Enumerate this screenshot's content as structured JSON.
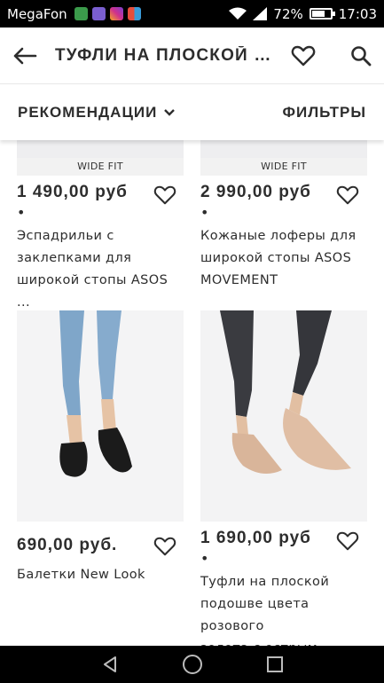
{
  "status_bar": {
    "carrier": "MegaFon",
    "battery": "72%",
    "time": "17:03",
    "battery_level": 0.72
  },
  "header": {
    "title": "ТУФЛИ НА ПЛОСКОЙ П..."
  },
  "sort_bar": {
    "sort_label": "РЕКОМЕНДАЦИИ",
    "filters_label": "ФИЛЬТРЫ"
  },
  "products": [
    {
      "badge": "WIDE FIT",
      "price": "1 490,00 руб",
      "dot": "•",
      "name_lines": [
        "Эспадрильи с",
        "заклепками для",
        "широкой стопы ASOS ..."
      ]
    },
    {
      "badge": "WIDE FIT",
      "price": "2 990,00 руб",
      "dot": "•",
      "name_lines": [
        "Кожаные лоферы для",
        "широкой стопы ASOS",
        "MOVEMENT"
      ]
    },
    {
      "price": "690,00 руб.",
      "name_lines": [
        "Балетки New Look"
      ]
    },
    {
      "price": "1 690,00 руб",
      "dot": "•",
      "name_lines": [
        "Туфли на плоской",
        "подошве цвета розового",
        "золота с острым носко..."
      ]
    }
  ]
}
